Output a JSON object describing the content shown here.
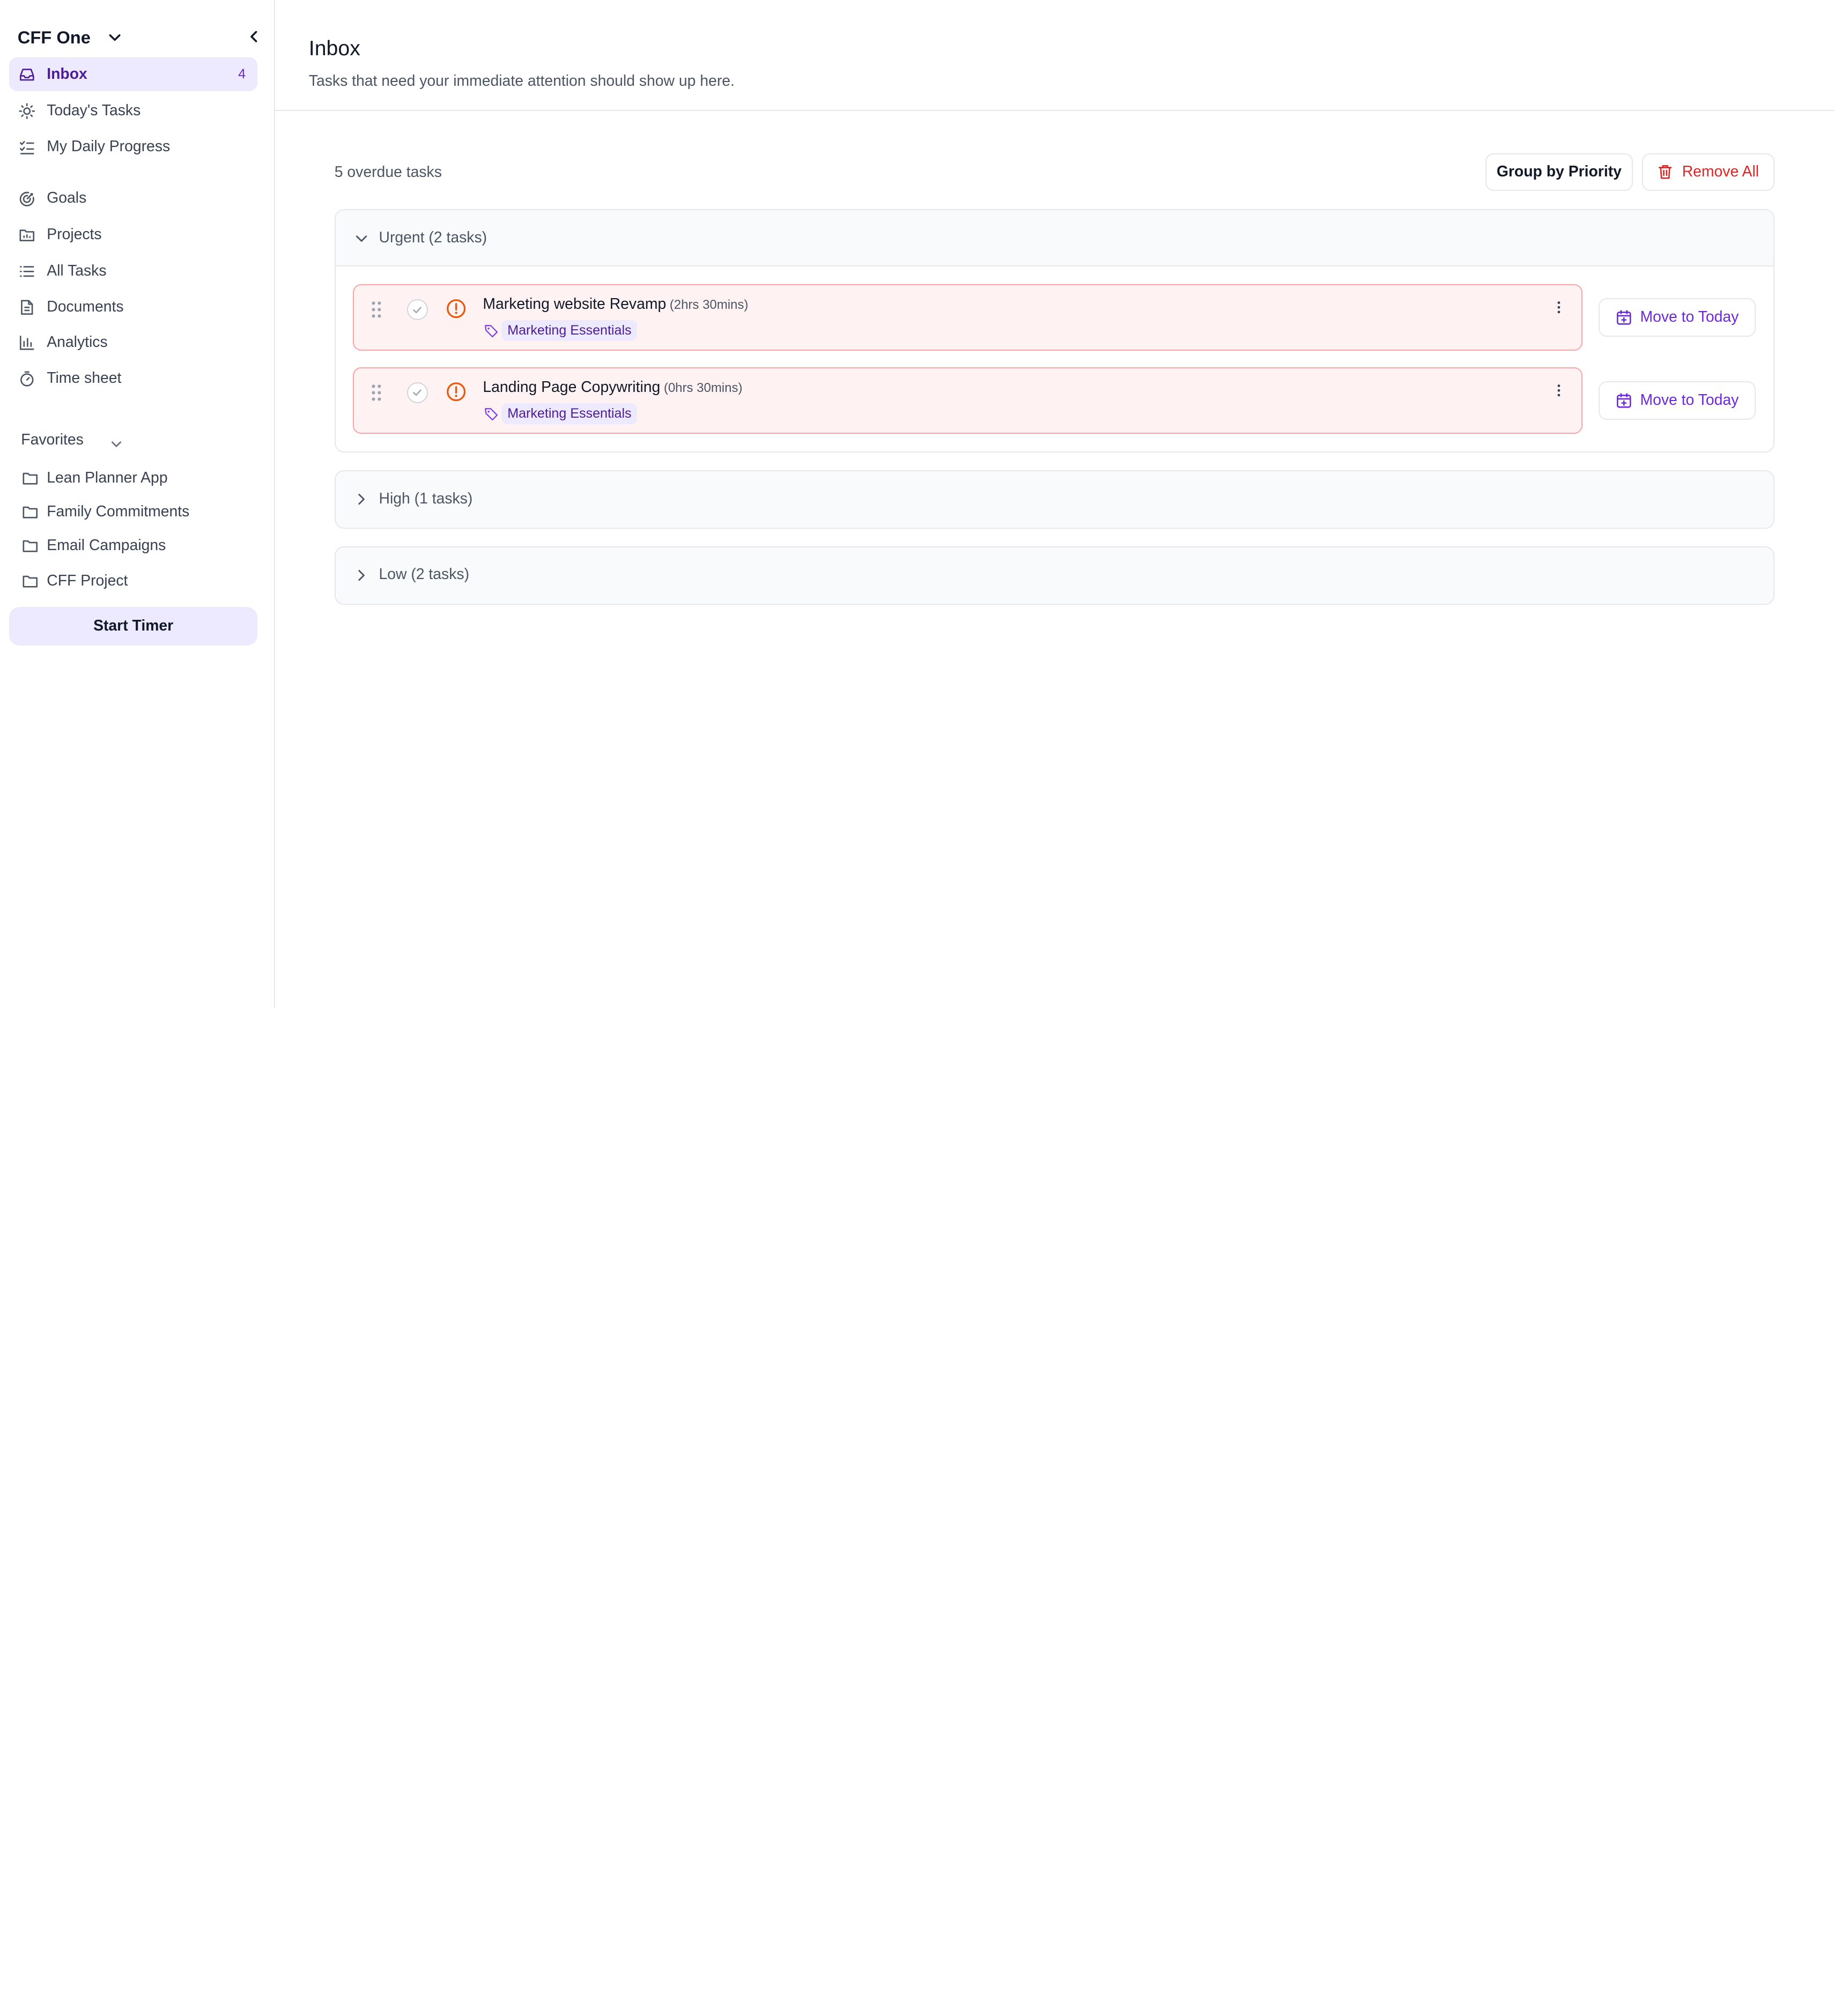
{
  "workspace": {
    "name": "CFF One"
  },
  "sidebar": {
    "nav": [
      {
        "label": "Inbox",
        "badge": "4",
        "icon": "inbox-icon",
        "active": true
      },
      {
        "label": "Today's Tasks",
        "icon": "sun-icon"
      },
      {
        "label": "My Daily Progress",
        "icon": "checklist-icon"
      },
      {
        "label": "Goals",
        "icon": "goal-icon"
      },
      {
        "label": "Projects",
        "icon": "projects-icon"
      },
      {
        "label": "All Tasks",
        "icon": "list-icon"
      },
      {
        "label": "Documents",
        "icon": "document-icon"
      },
      {
        "label": "Analytics",
        "icon": "chart-icon"
      },
      {
        "label": "Time sheet",
        "icon": "timer-icon"
      }
    ],
    "favorites_title": "Favorites",
    "favorites": [
      {
        "label": "Lean Planner App",
        "icon": "folder-icon"
      },
      {
        "label": "Family Commitments",
        "icon": "folder-icon"
      },
      {
        "label": "Email Campaigns",
        "icon": "folder-icon"
      },
      {
        "label": "CFF Project",
        "icon": "folder-icon"
      }
    ],
    "start_timer": "Start Timer"
  },
  "header": {
    "title": "Inbox",
    "subtitle": "Tasks that need your immediate attention should show up here."
  },
  "toolbar": {
    "overdue": "5 overdue tasks",
    "group_by": "Group by Priority",
    "remove_all": "Remove All"
  },
  "groups": [
    {
      "label": "Urgent (2 tasks)",
      "expanded": true,
      "tasks": [
        {
          "title": "Marketing website Revamp",
          "duration": "(2hrs 30mins)",
          "tag": "Marketing Essentials",
          "action": "Move to Today"
        },
        {
          "title": "Landing Page Copywriting",
          "duration": "(0hrs 30mins)",
          "tag": "Marketing Essentials",
          "action": "Move to Today"
        }
      ]
    },
    {
      "label": "High (1 tasks)",
      "expanded": false
    },
    {
      "label": "Low (2 tasks)",
      "expanded": false
    }
  ],
  "colors": {
    "accent": "#6d28d9",
    "accent_light": "#ede9fe",
    "urgent_bg": "#fef2f2",
    "urgent_border": "#fca5a5",
    "urgent_icon": "#ea580c",
    "danger": "#dc2626"
  }
}
